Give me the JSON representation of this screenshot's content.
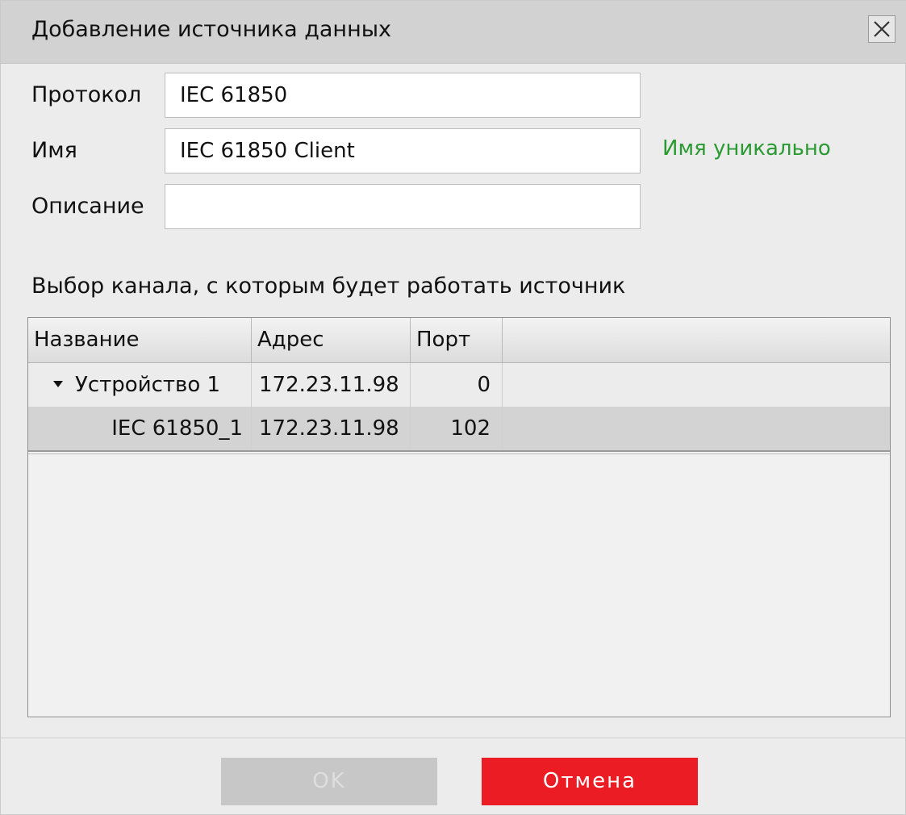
{
  "dialog": {
    "title": "Добавление источника данных"
  },
  "form": {
    "protocol_label": "Протокол",
    "protocol_value": "IEC 61850",
    "name_label": "Имя",
    "name_value": "IEC 61850 Client",
    "name_status": "Имя уникально",
    "name_status_color": "#2a9a32",
    "description_label": "Описание",
    "description_value": ""
  },
  "channels": {
    "section_title": "Выбор канала, с которым будет работать источник",
    "columns": [
      "Название",
      "Адрес",
      "Порт"
    ],
    "rows": [
      {
        "name": "Устройство 1",
        "address": "172.23.11.98",
        "port": "0",
        "expanded": true,
        "level": 0
      },
      {
        "name": "IEC 61850_1",
        "address": "172.23.11.98",
        "port": "102",
        "selected": true,
        "level": 1
      }
    ]
  },
  "footer": {
    "ok_label": "OK",
    "cancel_label": "Отмена",
    "cancel_color": "#ec1c24"
  }
}
